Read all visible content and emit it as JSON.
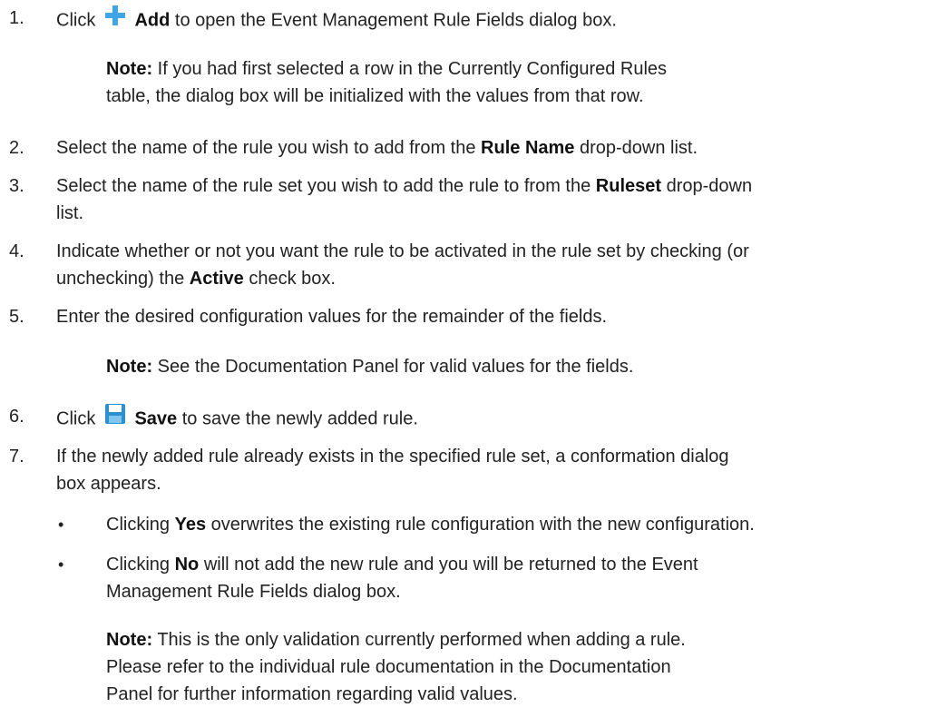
{
  "steps": [
    {
      "number": "1.",
      "pre": "Click",
      "action": "Add",
      "post": "to open the Event Management Rule Fields dialog box.",
      "icon": "plus-icon",
      "note_label": "Note:",
      "note_line1": "If you had first selected a row in the Currently Configured Rules",
      "note_line2": "table, the dialog box will be initialized with the values from that row."
    },
    {
      "number": "2.",
      "pre": "Select the name of the rule you wish to add from the",
      "field": "Rule Name",
      "post": "drop-down list."
    },
    {
      "number": "3.",
      "pre": "Select the name of the rule set you wish to add the rule to from the",
      "field": "Ruleset",
      "post": "drop-down",
      "line2": "list."
    },
    {
      "number": "4.",
      "line1": "Indicate whether or not you want the rule to be activated in the rule set by checking (or",
      "pre": "unchecking) the",
      "field": "Active",
      "post": "check box."
    },
    {
      "number": "5.",
      "text": "Enter the desired configuration values for the remainder of the fields.",
      "note_label": "Note:",
      "note_text": "See the Documentation Panel for valid values for the fields."
    },
    {
      "number": "6.",
      "pre": "Click",
      "action": "Save",
      "post": "to save the newly added rule.",
      "icon": "save-icon"
    },
    {
      "number": "7.",
      "line1": "If the newly added rule already exists in the specified rule set, a conformation dialog",
      "line2": "box appears.",
      "bullets": [
        {
          "dot": "•",
          "pre": "Clicking",
          "field": "Yes",
          "post": "overwrites the existing rule configuration with the new configuration."
        },
        {
          "dot": "•",
          "pre": "Clicking",
          "field": "No",
          "post": "will not add the new rule and you will be returned to the Event",
          "line2": "Management Rule Fields dialog box."
        }
      ],
      "note_label": "Note:",
      "note_line1": "This is the only validation currently performed when adding a rule.",
      "note_line2": "Please refer to the individual rule documentation in the Documentation",
      "note_line3": "Panel for further information regarding valid values."
    }
  ],
  "colors": {
    "icon_blue": "#3ea6e6",
    "icon_blue_dark": "#2b8fd0",
    "text": "#222222"
  }
}
